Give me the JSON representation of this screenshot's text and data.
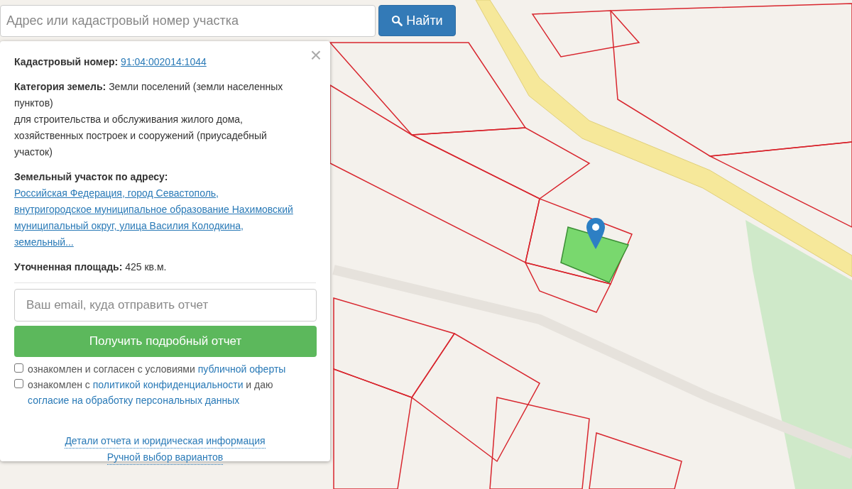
{
  "search": {
    "placeholder": "Адрес или кадастровый номер участка",
    "button": "Найти"
  },
  "panel": {
    "close": "×",
    "fields": [
      {
        "kind": "link",
        "label": "Кадастровый номер:",
        "value": [
          "91:04:002014:1044"
        ]
      },
      {
        "kind": "text",
        "label": "Категория земель:",
        "value": [
          "Земли поселений (земли населенных пунктов)",
          "для строительства и обслуживания жилого дома, хозяйственных построек и сооружений (приусадебный участок)"
        ]
      },
      {
        "kind": "link",
        "label": "Земельный участок по адресу:",
        "value": [
          "Российская Федерация, город Севастополь, внутригородское муниципальное образование Нахимовский муниципальный округ, улица Василия Колодкина, земельный..."
        ]
      },
      {
        "kind": "text",
        "label": "Уточненная площадь:",
        "value": [
          "425 кв.м."
        ]
      }
    ],
    "email_placeholder": "Ваш email, куда отправить отчет",
    "submit": "Получить подробный отчет",
    "consents": [
      {
        "checked": false,
        "parts": [
          {
            "kind": "text",
            "text": "ознакомлен и согласен с условиями "
          },
          {
            "kind": "link",
            "text": "публичной оферты"
          }
        ]
      },
      {
        "checked": false,
        "parts": [
          {
            "kind": "text",
            "text": "ознакомлен с "
          },
          {
            "kind": "link",
            "text": "политикой конфиденциальности"
          },
          {
            "kind": "text",
            "text": " и даю "
          },
          {
            "kind": "link",
            "text": "согласие на обработку персональных данных"
          }
        ]
      }
    ],
    "footer_links": [
      "Детали отчета и юридическая информация",
      "Ручной выбор вариантов"
    ]
  }
}
